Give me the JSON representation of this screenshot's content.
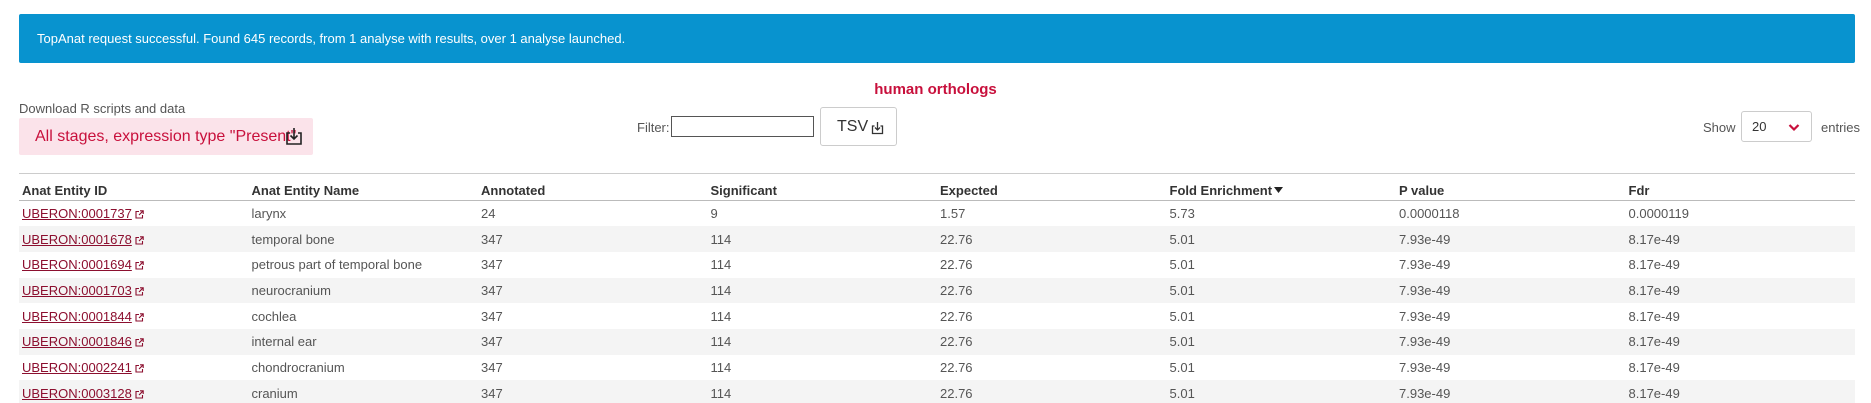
{
  "alert": {
    "message": "TopAnat request successful. Found 645 records, from 1 analyse with results, over 1 analyse launched."
  },
  "download": {
    "label": "Download R scripts and data",
    "button_label": "All stages, expression type \"Present\""
  },
  "title": "human orthologs",
  "filter": {
    "label": "Filter:",
    "value": ""
  },
  "tsv_button": "TSV",
  "length": {
    "show_label": "Show",
    "selected": "20",
    "entries_label": "entries"
  },
  "table": {
    "headers": [
      "Anat Entity ID",
      "Anat Entity Name",
      "Annotated",
      "Significant",
      "Expected",
      "Fold Enrichment",
      "P value",
      "Fdr"
    ],
    "sorted_column": "Fold Enrichment",
    "rows": [
      [
        "UBERON:0001737",
        "larynx",
        "24",
        "9",
        "1.57",
        "5.73",
        "0.0000118",
        "0.0000119"
      ],
      [
        "UBERON:0001678",
        "temporal bone",
        "347",
        "114",
        "22.76",
        "5.01",
        "7.93e-49",
        "8.17e-49"
      ],
      [
        "UBERON:0001694",
        "petrous part of temporal bone",
        "347",
        "114",
        "22.76",
        "5.01",
        "7.93e-49",
        "8.17e-49"
      ],
      [
        "UBERON:0001703",
        "neurocranium",
        "347",
        "114",
        "22.76",
        "5.01",
        "7.93e-49",
        "8.17e-49"
      ],
      [
        "UBERON:0001844",
        "cochlea",
        "347",
        "114",
        "22.76",
        "5.01",
        "7.93e-49",
        "8.17e-49"
      ],
      [
        "UBERON:0001846",
        "internal ear",
        "347",
        "114",
        "22.76",
        "5.01",
        "7.93e-49",
        "8.17e-49"
      ],
      [
        "UBERON:0002241",
        "chondrocranium",
        "347",
        "114",
        "22.76",
        "5.01",
        "7.93e-49",
        "8.17e-49"
      ],
      [
        "UBERON:0003128",
        "cranium",
        "347",
        "114",
        "22.76",
        "5.01",
        "7.93e-49",
        "8.17e-49"
      ]
    ]
  },
  "colors": {
    "alert_bg": "#0893cf",
    "accent": "#c8103c",
    "link": "#8c0f2f",
    "download_bg": "#fbe3ea"
  },
  "icons": {
    "download": "download-icon",
    "external_link": "external-link-icon",
    "dropdown": "chevron-down-icon",
    "sort": "sort-desc-icon"
  }
}
